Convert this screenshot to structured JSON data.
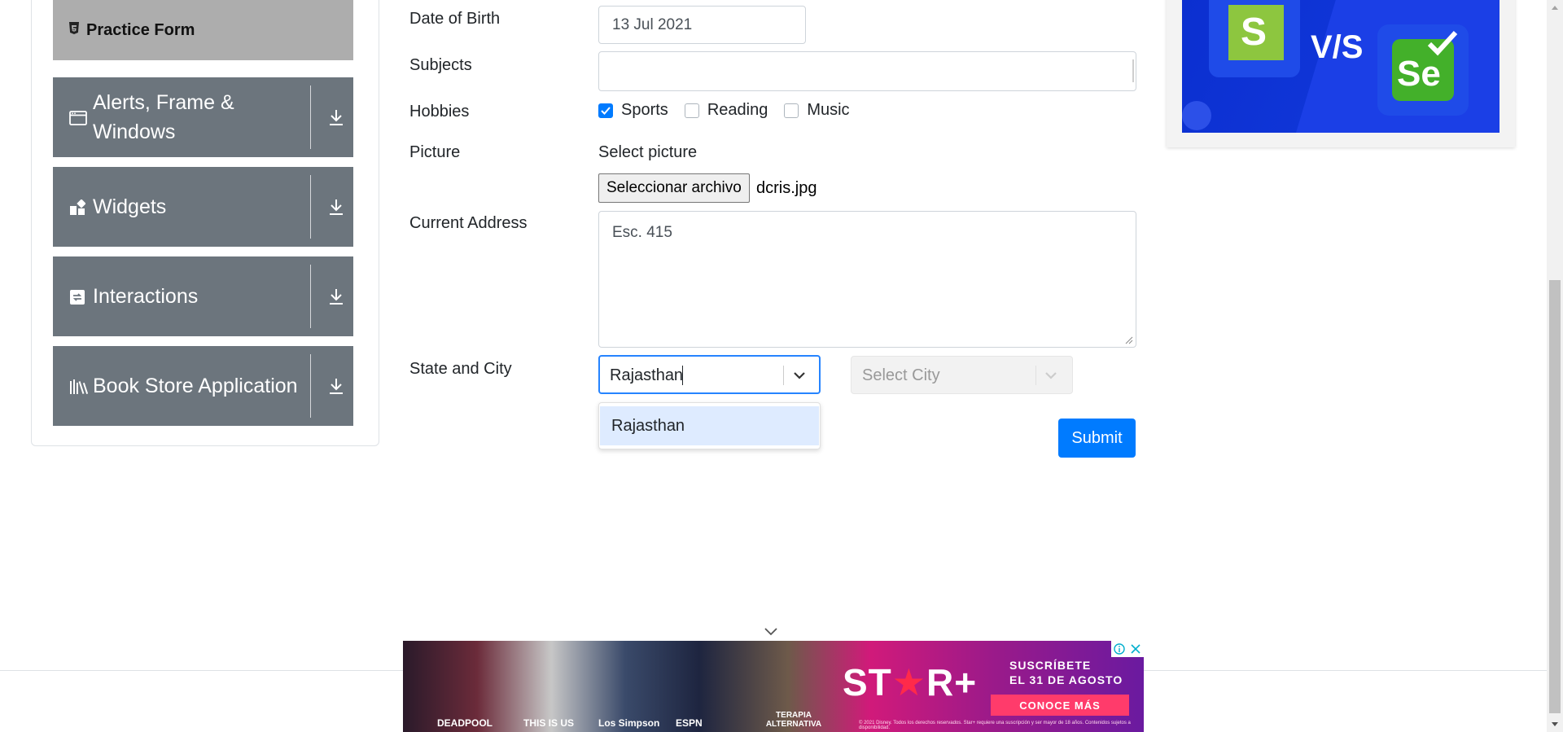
{
  "sidebar": {
    "active_item": {
      "label": "Practice Form",
      "icon": "html5-icon"
    },
    "groups": [
      {
        "label": "Alerts, Frame & Windows",
        "icon": "window-icon"
      },
      {
        "label": "Widgets",
        "icon": "widgets-icon"
      },
      {
        "label": "Interactions",
        "icon": "interactions-icon"
      },
      {
        "label": "Book Store Application",
        "icon": "books-icon"
      }
    ]
  },
  "form": {
    "dob": {
      "label": "Date of Birth",
      "value": "13 Jul 2021"
    },
    "subjects": {
      "label": "Subjects",
      "value": ""
    },
    "hobbies": {
      "label": "Hobbies",
      "options": [
        {
          "label": "Sports",
          "checked": true
        },
        {
          "label": "Reading",
          "checked": false
        },
        {
          "label": "Music",
          "checked": false
        }
      ]
    },
    "picture": {
      "label": "Picture",
      "caption": "Select picture",
      "button": "Seleccionar archivo",
      "file_name": "dcris.jpg"
    },
    "address": {
      "label": "Current Address",
      "value": "Esc. 415"
    },
    "state_city": {
      "label": "State and City",
      "state_input": "Rajasthan",
      "state_options": [
        "Rajasthan"
      ],
      "city_placeholder": "Select City"
    },
    "submit": "Submit"
  },
  "right_ad": {
    "left_logo_letter": "S",
    "vs": "V/S",
    "right_logo_text": "Se"
  },
  "bottom_ad": {
    "brand": "ST+R+",
    "promo_line1": "SUSCRÍBETE",
    "promo_line2": "EL 31 DE AGOSTO",
    "cta": "CONOCE MÁS",
    "captions": [
      "DEADPOOL",
      "THIS IS US",
      "Los Simpson",
      "ESPN",
      "TERAPIA ALTERNATIVA"
    ],
    "fine_print": "© 2021 Disney. Todos los derechos reservados. Star+ requiere una suscripción y ser mayor de 18 años. Contenidos sujetos a disponibilidad."
  },
  "colors": {
    "primary": "#007bff",
    "sidebar_group": "#6c757d",
    "sidebar_active": "#adadad",
    "select_focus": "#2684ff",
    "option_highlight": "#deebff"
  }
}
